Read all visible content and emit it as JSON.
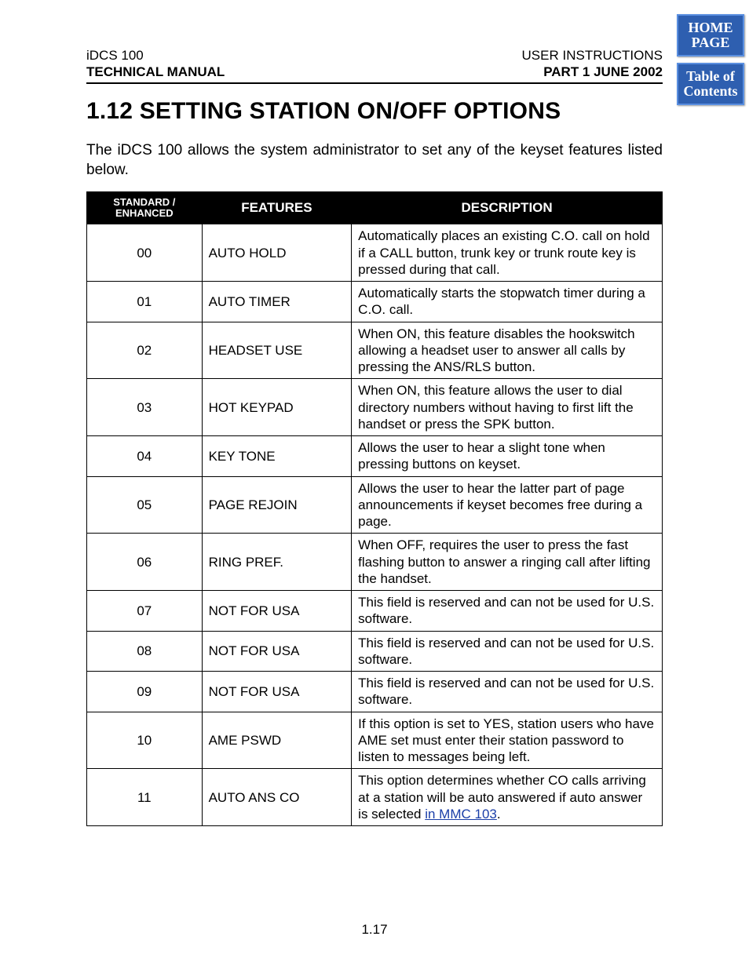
{
  "nav": {
    "home_label": "HOME\nPAGE",
    "toc_label": "Table of\nContents"
  },
  "header": {
    "left_top": "iDCS 100",
    "left_bottom": "TECHNICAL MANUAL",
    "right_top": "USER INSTRUCTIONS",
    "right_bottom": "PART 1   JUNE  2002"
  },
  "title": "1.12 SETTING STATION ON/OFF OPTIONS",
  "intro": "The iDCS 100 allows the system administrator to set any of the keyset features listed below.",
  "table": {
    "headers": {
      "col1_line1": "STANDARD /",
      "col1_line2": "ENHANCED",
      "col2": "FEATURES",
      "col3": "DESCRIPTION"
    },
    "rows": [
      {
        "se": "00",
        "feature": "AUTO HOLD",
        "desc": "Automatically places an existing C.O. call on hold if a CALL button, trunk key or trunk route key is pressed during that call."
      },
      {
        "se": "01",
        "feature": "AUTO TIMER",
        "desc": "Automatically starts the stopwatch timer during a C.O. call."
      },
      {
        "se": "02",
        "feature": "HEADSET USE",
        "desc": "When ON, this feature disables the hookswitch allowing a headset user to answer all calls by pressing the ANS/RLS button."
      },
      {
        "se": "03",
        "feature": "HOT KEYPAD",
        "desc": "When ON, this feature allows the user to dial directory numbers without having to first lift the handset or press the SPK button."
      },
      {
        "se": "04",
        "feature": "KEY TONE",
        "desc": "Allows the user to hear a slight tone when pressing buttons on keyset."
      },
      {
        "se": "05",
        "feature": "PAGE REJOIN",
        "desc": "Allows the user to hear the latter part of page announcements if keyset becomes free during a page."
      },
      {
        "se": "06",
        "feature": "RING PREF.",
        "desc": "When OFF, requires the user to press the fast flashing button to answer a ringing call after lifting the handset."
      },
      {
        "se": "07",
        "feature": "NOT FOR USA",
        "desc": "This field is reserved and can not be used for U.S. software."
      },
      {
        "se": "08",
        "feature": "NOT FOR USA",
        "desc": "This field is reserved and can not be used for U.S. software."
      },
      {
        "se": "09",
        "feature": "NOT FOR USA",
        "desc": "This field is reserved and can not be used for U.S. software."
      },
      {
        "se": "10",
        "feature": "AME PSWD",
        "desc": "If this option is set to YES, station users who have AME set must enter their station password to listen to messages being left."
      },
      {
        "se": "11",
        "feature": "AUTO ANS CO",
        "desc": "This option determines whether CO calls arriving at a station will be auto answered if auto answer is selected ",
        "link_text": "in MMC 103",
        "desc_tail": "."
      }
    ]
  },
  "page_number": "1.17"
}
